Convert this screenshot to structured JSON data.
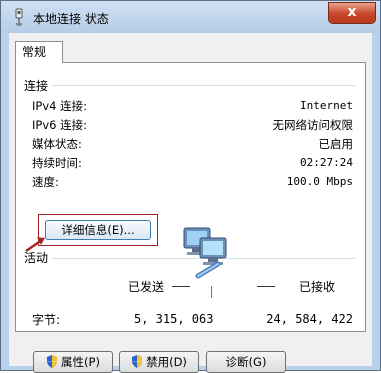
{
  "window": {
    "title": "本地连接 状态",
    "close_label": "x"
  },
  "tabs": [
    {
      "label": "常规"
    }
  ],
  "connection": {
    "section_label": "连接",
    "rows": [
      {
        "label": "IPv4 连接:",
        "value": "Internet"
      },
      {
        "label": "IPv6 连接:",
        "value": "无网络访问权限"
      },
      {
        "label": "媒体状态:",
        "value": "已启用"
      },
      {
        "label": "持续时间:",
        "value": "02:27:24"
      },
      {
        "label": "速度:",
        "value": "100.0 Mbps"
      }
    ],
    "details_button": "详细信息(E)..."
  },
  "activity": {
    "section_label": "活动",
    "sent_label": "已发送",
    "received_label": "已接收",
    "bytes_label": "字节:",
    "bytes_sent": "5, 315, 063",
    "bytes_received": "24, 584, 422"
  },
  "buttons": {
    "properties": "属性(P)",
    "disable": "禁用(D)",
    "diagnose": "诊断(G)"
  },
  "colors": {
    "highlight_frame": "#a3262a",
    "arrow": "#a3262a",
    "titlebar": "#b9d1ea"
  }
}
